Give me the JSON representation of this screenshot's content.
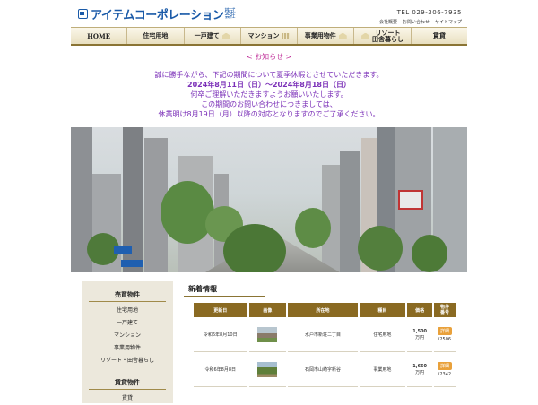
{
  "header": {
    "logo_text": "アイテムコーポレーション",
    "logo_suffix": "株式会社",
    "tel": "TEL 029-306-7935",
    "util_links": [
      "会社概要",
      "お問い合わせ",
      "サイトマップ"
    ]
  },
  "nav": [
    {
      "label": "HOME"
    },
    {
      "label": "住宅用地"
    },
    {
      "label": "一戸建て"
    },
    {
      "label": "マンション"
    },
    {
      "label": "事業用物件"
    },
    {
      "label": "リゾート\n田舎暮らし"
    },
    {
      "label": "賃貸"
    }
  ],
  "notice": {
    "title": "< お知らせ >",
    "lines": [
      "誠に勝手ながら、下記の期間について夏季休暇とさせていただきます。",
      "2024年8月11日（日）～2024年8月18日（日）",
      "何卒ご理解いただきますようお願いいたします。",
      "この期間のお問い合わせにつきましては、",
      "休業明け8月19日（月）以降の対応となりますのでご了承ください。"
    ]
  },
  "sidebar": {
    "sale_heading": "売買物件",
    "sale_items": [
      "住宅用地",
      "一戸建て",
      "マンション",
      "事業用物件",
      "リゾート・田舎暮らし"
    ],
    "rent_heading": "賃貸物件",
    "rent_items": [
      "賃貸"
    ]
  },
  "listings": {
    "title": "新着情報",
    "columns": [
      "更新日",
      "画像",
      "所在地",
      "種目",
      "価格",
      "物件\n番号"
    ],
    "rows": [
      {
        "date": "令和6年8月10日",
        "location": "水戸市新荘二丁目",
        "type": "住宅用地",
        "price": "1,500",
        "unit": "万円",
        "button": "詳細",
        "number": "i2506"
      },
      {
        "date": "令和6年8月8日",
        "location": "石岡市山崎字新谷",
        "type": "事業用地",
        "price": "1,660",
        "unit": "万円",
        "button": "詳細",
        "number": "i2342"
      }
    ]
  }
}
